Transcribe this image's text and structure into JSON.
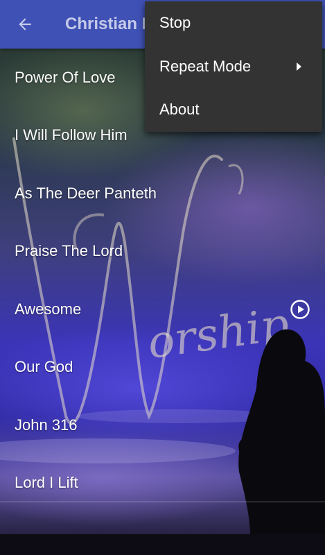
{
  "app_bar": {
    "title": "Christian I",
    "back_icon": "arrow-left-icon",
    "background_color": "#3f51b5",
    "title_color": "#c5cae9"
  },
  "songs": [
    {
      "title": "Power Of Love",
      "playing": false
    },
    {
      "title": "I Will Follow Him",
      "playing": false
    },
    {
      "title": "As The Deer Panteth",
      "playing": false
    },
    {
      "title": "Praise The Lord",
      "playing": false
    },
    {
      "title": "Awesome",
      "playing": true
    },
    {
      "title": "Our God",
      "playing": false
    },
    {
      "title": "John 316",
      "playing": false
    },
    {
      "title": "Lord I Lift",
      "playing": false
    }
  ],
  "overflow_menu": {
    "items": [
      {
        "label": "Stop",
        "has_submenu": false
      },
      {
        "label": "Repeat Mode",
        "has_submenu": true
      },
      {
        "label": "About",
        "has_submenu": false
      }
    ],
    "background_color": "#333333"
  }
}
